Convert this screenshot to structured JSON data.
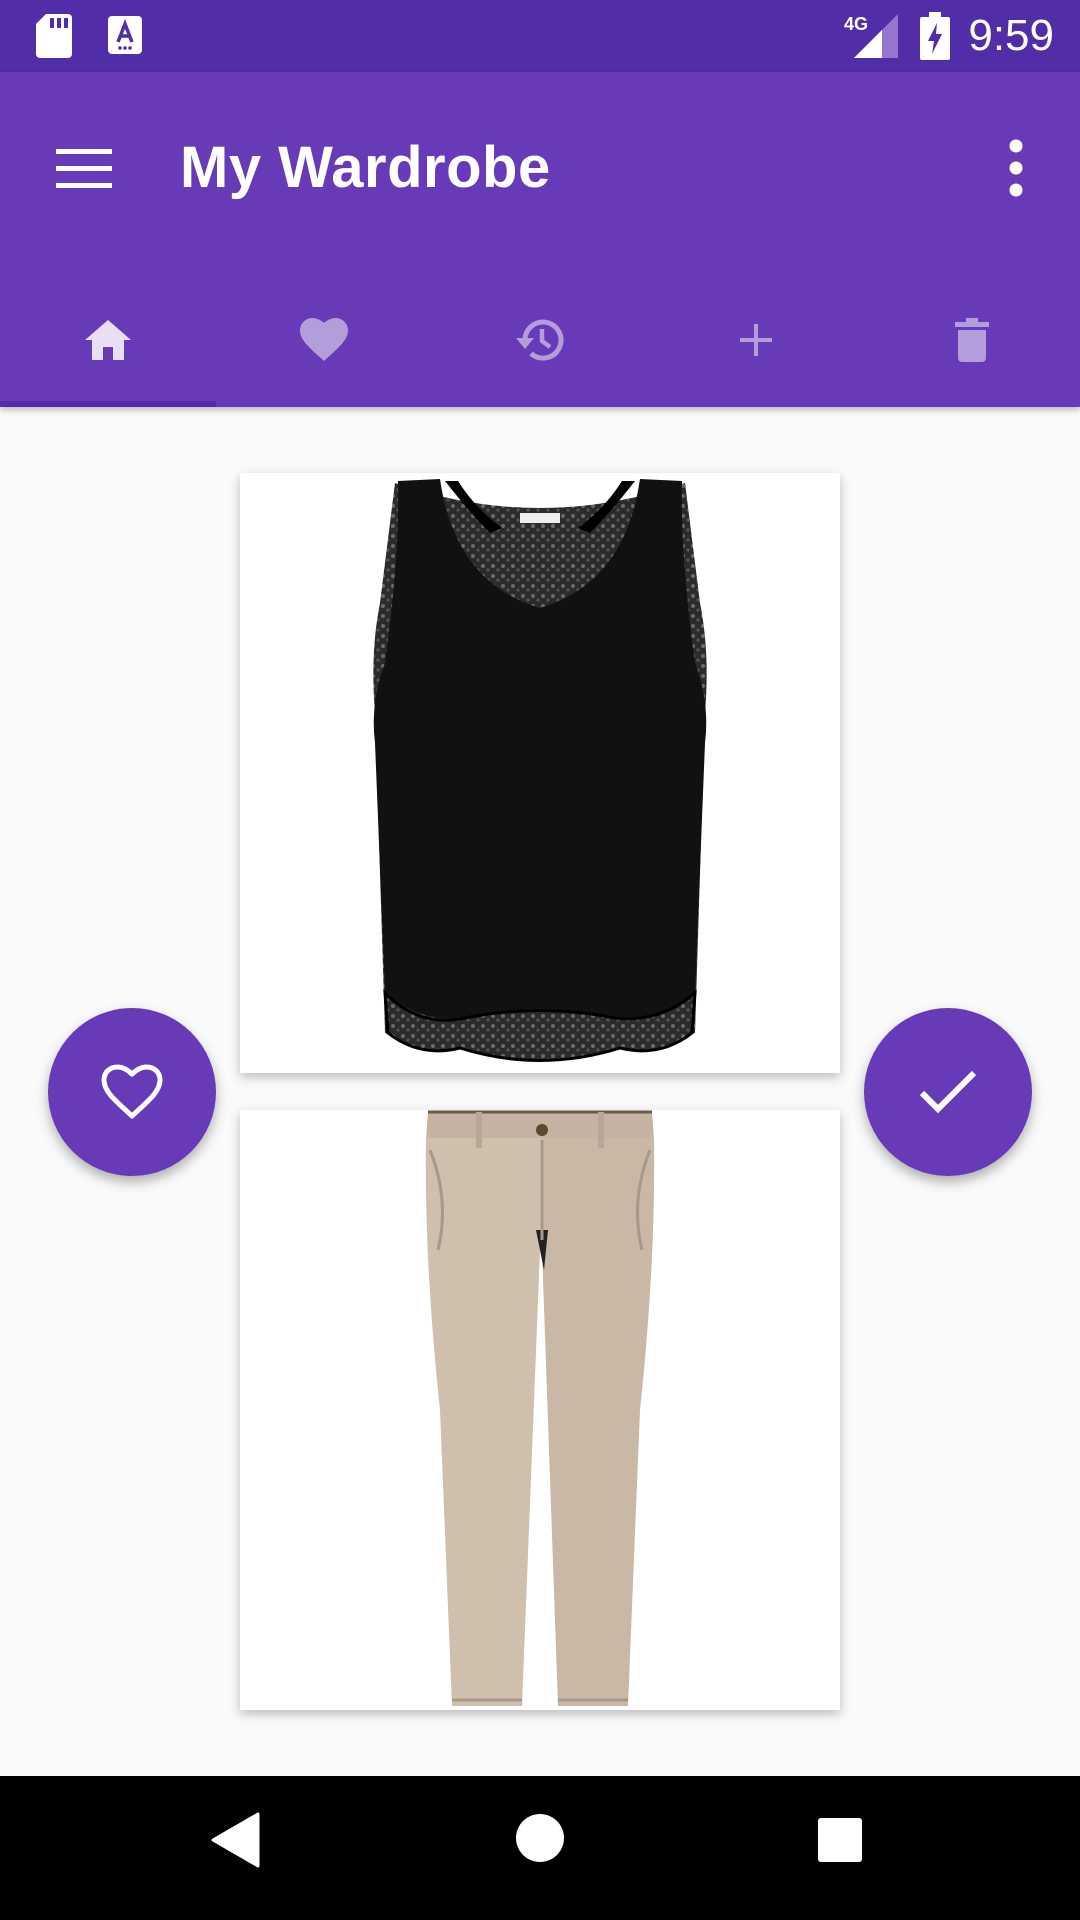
{
  "status_bar": {
    "network": "4G",
    "time": "9:59",
    "icons": [
      "sd-card-icon",
      "keyboard-a-icon",
      "signal-4g-icon",
      "battery-charging-icon"
    ]
  },
  "app_bar": {
    "title": "My Wardrobe",
    "menu_icon": "hamburger-menu-icon",
    "overflow_icon": "more-vertical-icon",
    "tabs": [
      {
        "icon": "home-icon",
        "selected": true
      },
      {
        "icon": "heart-icon",
        "selected": false
      },
      {
        "icon": "history-icon",
        "selected": false
      },
      {
        "icon": "plus-icon",
        "selected": false
      },
      {
        "icon": "trash-icon",
        "selected": false
      }
    ]
  },
  "outfit": {
    "items": [
      {
        "image": "black-sleeveless-top",
        "category": "top"
      },
      {
        "image": "beige-chino-pants",
        "category": "bottom"
      }
    ]
  },
  "actions": {
    "favorite_icon": "heart-outline-icon",
    "confirm_icon": "check-icon"
  },
  "nav_bar": {
    "icons": [
      "back-icon",
      "home-circle-icon",
      "recents-icon"
    ]
  },
  "colors": {
    "primary": "#673ab7",
    "primary_dark": "#512da8",
    "tab_selected": "#e8dff5",
    "tab_unselected": "#b39ddb",
    "background": "#fafafa"
  }
}
